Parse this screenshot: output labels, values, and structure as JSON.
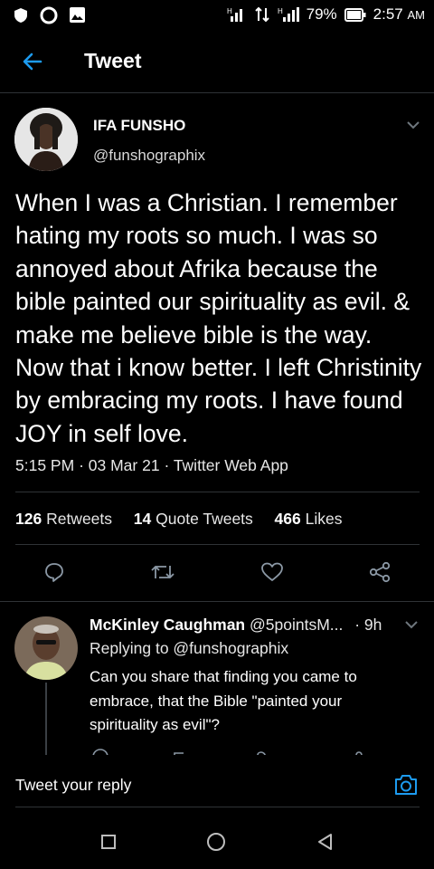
{
  "status_bar": {
    "battery": "79%",
    "time": "2:57",
    "ampm": "AM",
    "signal_label": "H"
  },
  "header": {
    "title": "Tweet"
  },
  "tweet": {
    "author_name": "IFA FUNSHO",
    "author_handle": "@funshographix",
    "text": "When I was a Christian. I remember hating my roots so much. I was so annoyed about Afrika because the bible painted our spirituality as evil. & make me believe bible is the way. Now that i know better. I left Christinity by embracing my roots. I have found JOY in self love.",
    "time": "5:15 PM",
    "date": "03 Mar 21",
    "source": "Twitter Web App",
    "separator": "·",
    "retweets_count": "126",
    "retweets_label": "Retweets",
    "quotes_count": "14",
    "quotes_label": "Quote Tweets",
    "likes_count": "466",
    "likes_label": "Likes"
  },
  "reply": {
    "author_name": "McKinley Caughman",
    "author_handle": "@5pointsM...",
    "time": "· 9h",
    "replying_to": "Replying to @funshographix",
    "text": "Can you share that finding you came to embrace, that the Bible \"painted your spirituality as evil\"?"
  },
  "compose": {
    "placeholder": "Tweet your reply"
  },
  "colors": {
    "accent": "#1d9bf0",
    "background": "#000000",
    "divider": "#2f3336"
  }
}
